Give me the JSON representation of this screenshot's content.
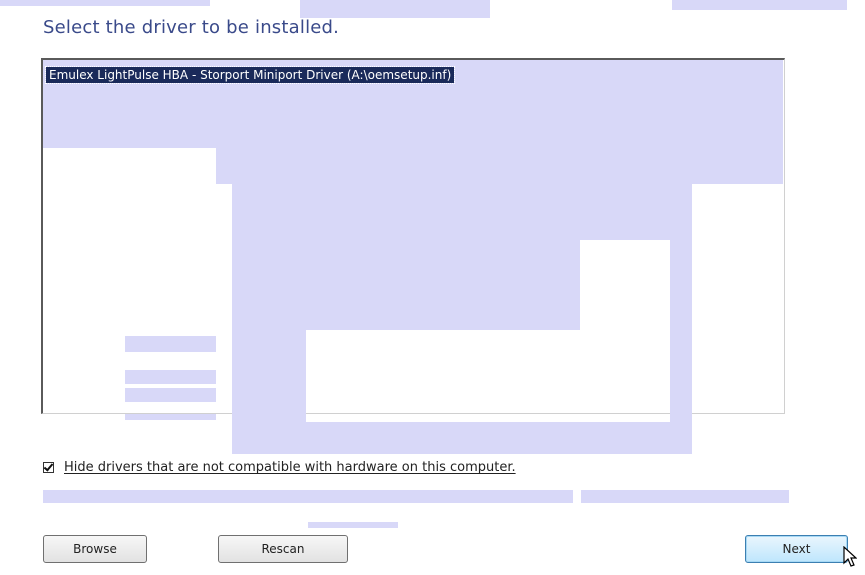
{
  "heading": "Select the driver to be installed.",
  "driver_list": {
    "items": [
      "Emulex LightPulse HBA - Storport Miniport Driver (A:\\oemsetup.inf)"
    ],
    "selected_index": 0
  },
  "hide_incompatible": {
    "label": "Hide drivers that are not compatible with hardware on this computer.",
    "checked": true
  },
  "buttons": {
    "browse": "Browse",
    "rescan": "Rescan",
    "next": "Next"
  },
  "colors": {
    "heading": "#3a4a8a",
    "selection": "#1a2a5a",
    "redaction": "#d8d8f8"
  },
  "icons": [
    "checkbox-check-icon",
    "mouse-cursor-icon"
  ]
}
